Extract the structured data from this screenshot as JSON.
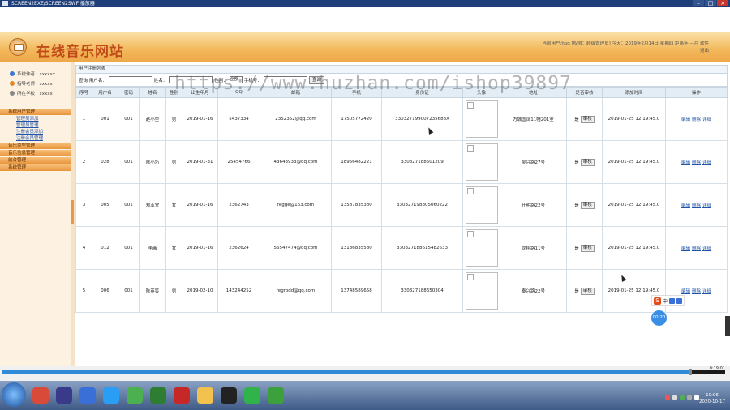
{
  "window": {
    "title": "SCREEN2EXE/SCREEN2SWF 播放器"
  },
  "header": {
    "site_title": "在线音乐网站",
    "user_info": "当前用户:hog [权限：超级管理员] 今天：2019年2月14日 星期四 距离年 —月 软件",
    "logout": "退出"
  },
  "sidebar": {
    "info": [
      {
        "label": "系统作者：xxxxxx",
        "color": "#3b7ad1"
      },
      {
        "label": "指导老师：xxxxx",
        "color": "#e0882a"
      },
      {
        "label": "所在学校：xxxxx",
        "color": "#888888"
      }
    ],
    "menu": [
      {
        "title": "系统用户管理",
        "subs": [
          "管理员添加",
          "管理员管理",
          "注册会员添加",
          "注册会员管理"
        ]
      },
      {
        "title": "音乐类型管理",
        "subs": []
      },
      {
        "title": "音乐信息管理",
        "subs": []
      },
      {
        "title": "前台管理",
        "subs": []
      },
      {
        "title": "系统管理",
        "subs": []
      }
    ]
  },
  "panel": {
    "title": "用户注册列表"
  },
  "search": {
    "username_label": "查询 用户名：",
    "name_label": "姓名：",
    "gender_label": "性别：",
    "gender_value": "全部",
    "phone_label": "手机号：",
    "query_button": "查询"
  },
  "table": {
    "columns": [
      "序号",
      "用户名",
      "密码",
      "姓名",
      "性别",
      "出生年月",
      "QQ",
      "邮箱",
      "手机",
      "身份证",
      "头像",
      "地址",
      "是否审核",
      "添加时间",
      "操作"
    ],
    "audit_button": "审核",
    "ops": [
      "编辑",
      "删除",
      "详细"
    ],
    "rows": [
      {
        "no": "1",
        "username": "001",
        "password": "001",
        "name": "赵小型",
        "gender": "男",
        "birth": "2019-01-16",
        "qq": "5437334",
        "email": "2352352@qq.com",
        "phone": "17505772420",
        "idcard": "330327199007235688X",
        "address": "方城国阔11幢201室",
        "audit": "是",
        "added": "2019-01-25 12:19:45.0"
      },
      {
        "no": "2",
        "username": "028",
        "password": "001",
        "name": "陈小巧",
        "gender": "男",
        "birth": "2019-01-31",
        "qq": "25454766",
        "email": "43643933@qq.com",
        "phone": "18956482221",
        "idcard": "330327188501209",
        "address": "吴兴路27号",
        "audit": "是",
        "added": "2019-01-25 12:19:45.0"
      },
      {
        "no": "3",
        "username": "005",
        "password": "001",
        "name": "郑亚堂",
        "gender": "女",
        "birth": "2019-01-16",
        "qq": "2362743",
        "email": "fegge@163.com",
        "phone": "13587835380",
        "idcard": "330327198805060222",
        "address": "开明路22号",
        "audit": "是",
        "added": "2019-01-25 12:19:45.0"
      },
      {
        "no": "4",
        "username": "012",
        "password": "001",
        "name": "李画",
        "gender": "女",
        "birth": "2019-01-16",
        "qq": "2362624",
        "email": "56547474@qq.com",
        "phone": "13186835580",
        "idcard": "330327188615482633",
        "address": "龙翔路11号",
        "audit": "是",
        "added": "2019-01-25 12:19:45.0"
      },
      {
        "no": "5",
        "username": "006",
        "password": "001",
        "name": "陈英笑",
        "gender": "男",
        "birth": "2019-02-10",
        "qq": "143244252",
        "email": "regrodd@qq.com",
        "phone": "13748589658",
        "idcard": "330327188650304",
        "address": "泰兴路22号",
        "audit": "是",
        "added": "2019-01-25 12:19:45.0"
      }
    ]
  },
  "watermark": "https://www.huzhan.com/ishop39897",
  "ime": {
    "logo": "S",
    "text": "中"
  },
  "float_badge": "00:20",
  "player": {
    "time": "0:19:01"
  },
  "taskbar": {
    "icons": [
      {
        "name": "chrome-icon",
        "color": "#d94a38"
      },
      {
        "name": "media-icon",
        "color": "#3a3a8a"
      },
      {
        "name": "explorer-icon",
        "color": "#3a6fd8"
      },
      {
        "name": "browser-icon",
        "color": "#2a9df4"
      },
      {
        "name": "leaf-icon",
        "color": "#4caf50"
      },
      {
        "name": "chart-icon",
        "color": "#2e7d32"
      },
      {
        "name": "flash-icon",
        "color": "#c62828"
      },
      {
        "name": "folder-icon",
        "color": "#f2c14e"
      },
      {
        "name": "qq-icon",
        "color": "#222222"
      },
      {
        "name": "wechat-icon",
        "color": "#2fb34a"
      },
      {
        "name": "player-icon",
        "color": "#3ca03c"
      }
    ],
    "clock_time": "19:06",
    "clock_date": "2020-10-17"
  }
}
